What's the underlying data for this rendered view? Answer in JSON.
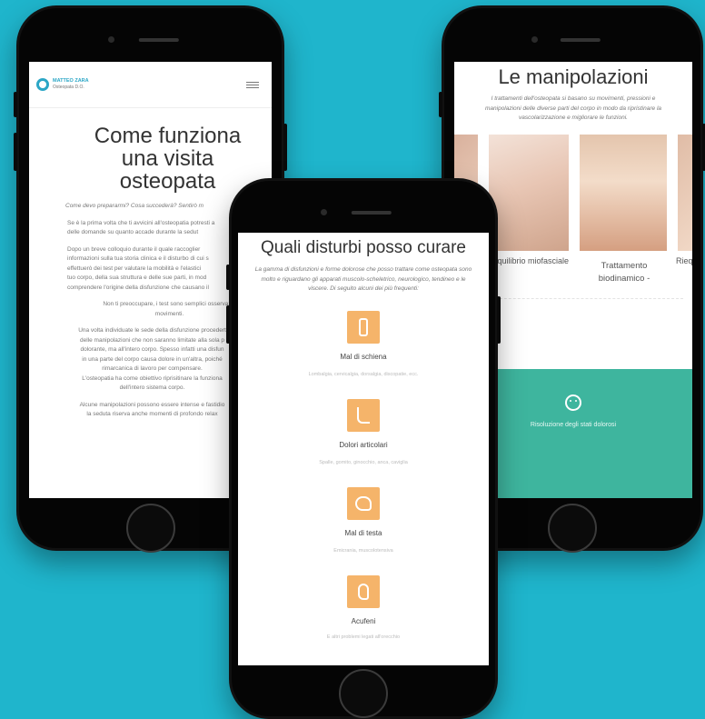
{
  "left_phone": {
    "logo_name": "MATTEO ZARA",
    "logo_sub": "Osteopata D.O.",
    "title_lines": [
      "Come funziona",
      "una visita",
      "osteopata"
    ],
    "intro_question": "Come devo prepararmi? Cosa succederà? Sentirò m",
    "para1": [
      "Se è la prima volta che ti avvicini all'osteopatia potresti a",
      "delle domande su quanto accade durante la sedut"
    ],
    "para2": [
      "Dopo un breve colloquio durante il quale raccoglier",
      "informazioni sulla tua storia clinica e il disturbo di cui s",
      "effettuerò dei test per valutare la mobilità e l'elastici",
      "tuo corpo, della sua struttura e delle sue parti, in mod",
      "comprendere l'origine della disfunzione che causano il"
    ],
    "para3": [
      "Non ti preoccupare, i test sono semplici osservazio",
      "movimenti."
    ],
    "para4": [
      "Una volta individuate le sede della disfunzione procedert",
      "delle manipolazioni che non saranno limitate alla sola p",
      "dolorante, ma all'intero corpo. Spesso infatti una disfun",
      "in una parte del corpo causa dolore in un'altra, poiché",
      "rimarcanica di lavoro per compensare.",
      "L'osteopatia ha come obiettivo riprisitinare la funziona",
      "dell'intero sistema corpo."
    ],
    "para5": [
      "Alcune manipolazioni possono essere intense e fastidio",
      "la seduta riserva anche momenti di profondo relax"
    ]
  },
  "right_phone": {
    "title": "Le manipolazioni",
    "subtitle": "I trattamenti dell'osteopata si basano su movimenti, pressioni e manipolazioni delle diverse parti del corpo in modo da ripristinare la vascolarizzazione e migliorare le funzioni.",
    "card_labels": [
      "Riequilibrio miofasciale",
      "Trattamento biodinamico -",
      "Riequ"
    ],
    "teal_item": "Risoluzione degli stati dolorosi",
    "colors": {
      "teal": "#3eb59e"
    }
  },
  "center_phone": {
    "title": "Quali disturbi posso curare",
    "intro": "La gamma di disfunzioni e forme dolorose che posso trattare come osteopata sono molto e riguardano gli apparati muscolo-scheletrico, neurologico, tendineo e le viscere. Di seguito alcuni dei più frequenti:",
    "items": [
      {
        "icon": "spine-icon",
        "label": "Mal di schiena",
        "desc": "Lombalgia, cervicalgia, dorsalgia, discopatie, ecc."
      },
      {
        "icon": "foot-icon",
        "label": "Dolori articolari",
        "desc": "Spalle, gomito, ginocchio, anca, caviglia"
      },
      {
        "icon": "head-icon",
        "label": "Mal di testa",
        "desc": "Emicrania, muscolotensiva"
      },
      {
        "icon": "ear-icon",
        "label": "Acufeni",
        "desc": "E altri problemi legati all'orecchio"
      }
    ],
    "colors": {
      "accent": "#f5b46a"
    }
  }
}
